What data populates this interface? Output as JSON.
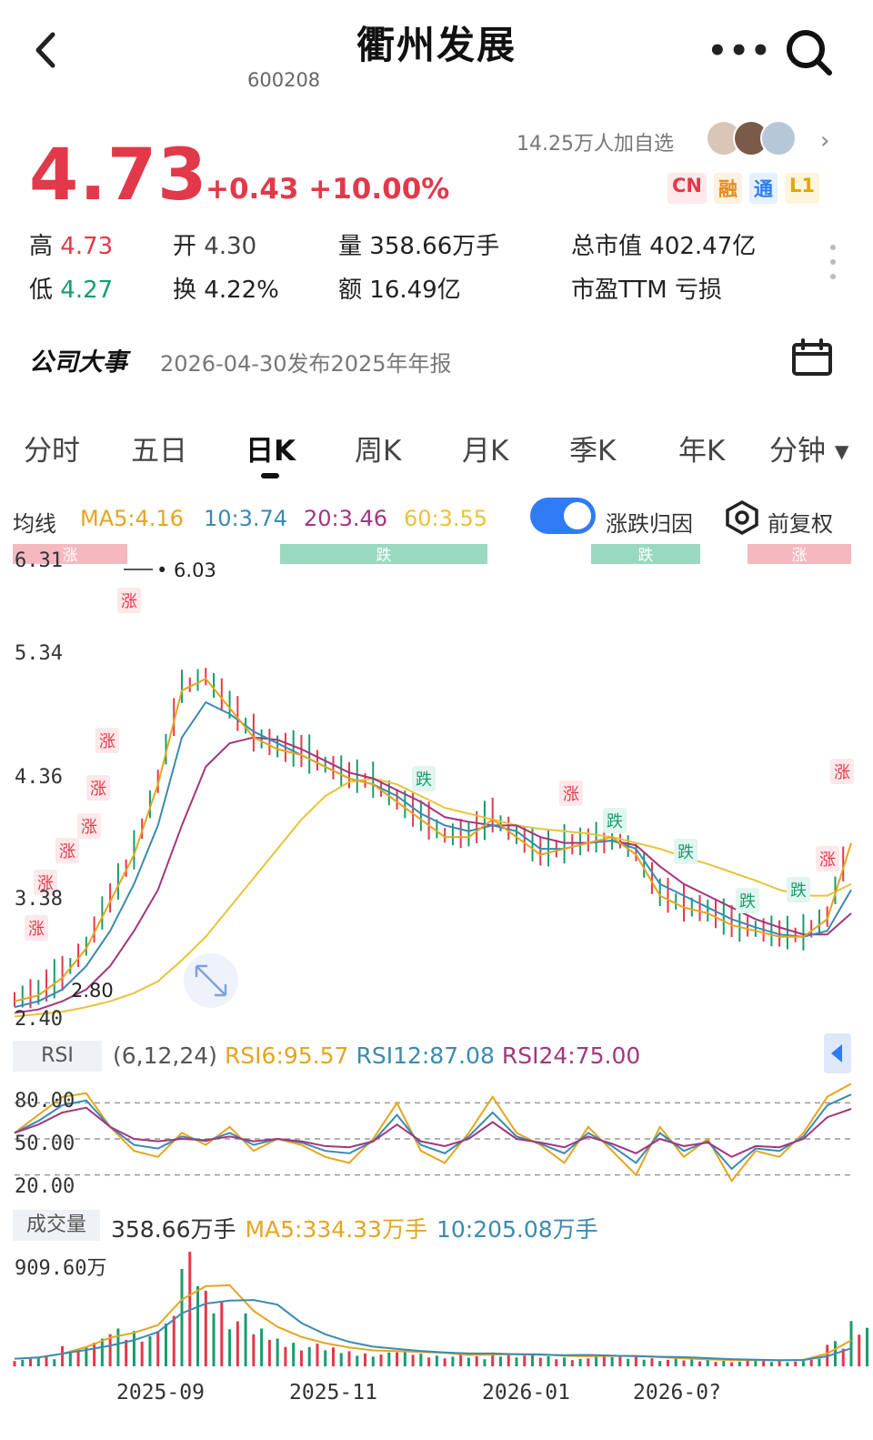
{
  "header": {
    "title": "衢州发展",
    "code": "600208",
    "more_icon": "more-icon",
    "search_icon": "search-icon"
  },
  "quote": {
    "price": "4.73",
    "change": "+0.43 +10.00%",
    "followers": "14.25万人加自选",
    "badges": [
      {
        "label": "CN",
        "color": "#e2394a",
        "bg": "#fde8ea"
      },
      {
        "label": "融",
        "color": "#e88a1a",
        "bg": "#fdf1e2"
      },
      {
        "label": "通",
        "color": "#2f7bf5",
        "bg": "#e6f0fe"
      },
      {
        "label": "L1",
        "color": "#e0a800",
        "bg": "#fdf5dc"
      }
    ],
    "stats": {
      "high_label": "高",
      "high": "4.73",
      "low_label": "低",
      "low": "4.27",
      "open_label": "开",
      "open": "4.30",
      "turnover_label": "换",
      "turnover": "4.22%",
      "volume_label": "量",
      "volume": "358.66万手",
      "amount_label": "额",
      "amount": "16.49亿",
      "mcap_label": "总市值",
      "mcap": "402.47亿",
      "pe_label": "市盈TTM",
      "pe": "亏损"
    }
  },
  "news": {
    "label": "公司大事",
    "text": "2026-04-30发布2025年年报"
  },
  "tabs": [
    {
      "label": "分时",
      "active": false
    },
    {
      "label": "五日",
      "active": false
    },
    {
      "label": "日K",
      "active": true
    },
    {
      "label": "周K",
      "active": false
    },
    {
      "label": "月K",
      "active": false
    },
    {
      "label": "季K",
      "active": false
    },
    {
      "label": "年K",
      "active": false
    },
    {
      "label": "分钟 ▾",
      "active": false
    }
  ],
  "ma": {
    "label": "均线",
    "ma5": "MA5:4.16",
    "ma10": "10:3.74",
    "ma20": "20:3.46",
    "ma60": "60:3.55",
    "colors": {
      "ma5": "#e5a520",
      "ma10": "#3b8ab3",
      "ma20": "#a3367e",
      "ma60": "#e8c33a"
    },
    "toggle_label": "涨跌归因",
    "toggle_on": true,
    "adjust_label": "前复权"
  },
  "chart_data": [
    {
      "type": "line",
      "title": "",
      "y_ticks": [
        "6.31",
        "5.34",
        "4.36",
        "3.38",
        "2.40"
      ],
      "ylim": [
        2.4,
        6.31
      ],
      "x_ticks": [
        "2025-09",
        "2025-11",
        "2026-01",
        "2026-0?"
      ],
      "annotations": {
        "max": "6.03",
        "min": "2.80"
      },
      "attribution_bars": [
        "涨",
        "跌",
        "跌",
        "涨"
      ],
      "event_tags": [
        "涨",
        "涨",
        "涨",
        "涨",
        "涨",
        "涨",
        "涨",
        "跌",
        "涨",
        "跌",
        "跌",
        "跌",
        "跌",
        "涨",
        "涨",
        "涨"
      ],
      "series": [
        {
          "name": "MA5",
          "color": "#e5a520",
          "values": [
            2.55,
            2.6,
            2.75,
            3.0,
            3.4,
            3.8,
            4.4,
            5.2,
            5.3,
            5.05,
            4.8,
            4.7,
            4.65,
            4.55,
            4.45,
            4.4,
            4.25,
            4.1,
            3.95,
            3.95,
            4.1,
            3.95,
            3.8,
            3.85,
            3.9,
            3.95,
            3.8,
            3.45,
            3.35,
            3.3,
            3.2,
            3.15,
            3.1,
            3.1,
            3.25,
            3.9
          ]
        },
        {
          "name": "MA10",
          "color": "#3b8ab3",
          "values": [
            2.5,
            2.55,
            2.65,
            2.85,
            3.15,
            3.55,
            4.05,
            4.8,
            5.1,
            5.0,
            4.85,
            4.75,
            4.65,
            4.55,
            4.45,
            4.4,
            4.3,
            4.15,
            4.05,
            4.0,
            4.05,
            4.0,
            3.85,
            3.85,
            3.9,
            3.92,
            3.85,
            3.55,
            3.45,
            3.35,
            3.25,
            3.18,
            3.12,
            3.1,
            3.15,
            3.5
          ]
        },
        {
          "name": "MA20",
          "color": "#a3367e",
          "values": [
            2.45,
            2.48,
            2.55,
            2.65,
            2.85,
            3.15,
            3.5,
            4.05,
            4.55,
            4.75,
            4.8,
            4.78,
            4.7,
            4.6,
            4.5,
            4.45,
            4.35,
            4.25,
            4.12,
            4.08,
            4.05,
            4.05,
            3.95,
            3.9,
            3.9,
            3.92,
            3.88,
            3.7,
            3.55,
            3.45,
            3.35,
            3.25,
            3.18,
            3.12,
            3.12,
            3.3
          ]
        },
        {
          "name": "MA60",
          "color": "#e8c33a",
          "values": [
            2.42,
            2.44,
            2.46,
            2.5,
            2.55,
            2.62,
            2.72,
            2.9,
            3.1,
            3.35,
            3.6,
            3.85,
            4.1,
            4.3,
            4.42,
            4.45,
            4.4,
            4.3,
            4.2,
            4.15,
            4.1,
            4.05,
            4.02,
            4.0,
            3.98,
            3.95,
            3.9,
            3.85,
            3.78,
            3.72,
            3.65,
            3.58,
            3.5,
            3.45,
            3.45,
            3.55
          ]
        }
      ]
    },
    {
      "type": "line",
      "title": "RSI",
      "params": "(6,12,24)",
      "labels": {
        "rsi6": "RSI6:95.57",
        "rsi12": "RSI12:87.08",
        "rsi24": "RSI24:75.00"
      },
      "y_ticks": [
        "80.00",
        "50.00",
        "20.00"
      ],
      "ylim": [
        0,
        100
      ],
      "series": [
        {
          "name": "RSI6",
          "color": "#e5a520",
          "values": [
            55,
            70,
            85,
            88,
            60,
            40,
            35,
            55,
            45,
            60,
            40,
            50,
            45,
            35,
            30,
            50,
            80,
            40,
            30,
            55,
            85,
            55,
            45,
            30,
            60,
            40,
            20,
            60,
            35,
            50,
            15,
            40,
            35,
            55,
            85,
            96
          ]
        },
        {
          "name": "RSI12",
          "color": "#3b8ab3",
          "values": [
            55,
            65,
            78,
            82,
            60,
            45,
            42,
            52,
            48,
            55,
            45,
            50,
            47,
            40,
            38,
            48,
            70,
            45,
            38,
            52,
            72,
            52,
            46,
            38,
            55,
            44,
            30,
            55,
            40,
            48,
            25,
            42,
            40,
            52,
            78,
            87
          ]
        },
        {
          "name": "RSI24",
          "color": "#a3367e",
          "values": [
            55,
            62,
            72,
            76,
            60,
            50,
            48,
            50,
            49,
            52,
            48,
            50,
            48,
            44,
            43,
            48,
            62,
            48,
            44,
            50,
            64,
            50,
            47,
            43,
            52,
            46,
            38,
            50,
            44,
            47,
            35,
            44,
            43,
            50,
            68,
            75
          ]
        }
      ]
    },
    {
      "type": "bar",
      "title": "成交量",
      "labels": {
        "vol": "358.66万手",
        "ma5": "MA5:334.33万手",
        "ma10": "10:205.08万手"
      },
      "y_ticks": [
        "909.60万"
      ],
      "ylim": [
        0,
        909.6
      ],
      "values": [
        60,
        80,
        160,
        220,
        300,
        280,
        400,
        909,
        600,
        420,
        300,
        220,
        180,
        150,
        120,
        110,
        130,
        100,
        90,
        80,
        110,
        100,
        80,
        70,
        90,
        85,
        75,
        60,
        55,
        50,
        45,
        50,
        45,
        60,
        200,
        359
      ]
    }
  ],
  "rsi_panel": {
    "tag": "RSI"
  },
  "volume_panel": {
    "tag": "成交量"
  }
}
